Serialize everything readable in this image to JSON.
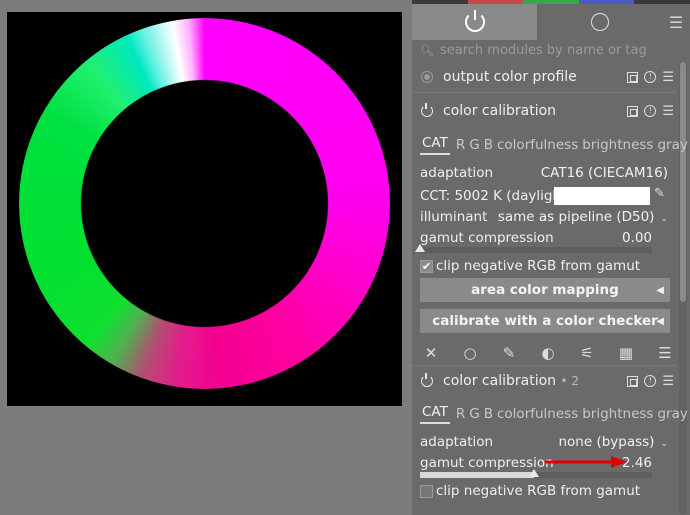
{
  "accent_colors": {
    "strip": [
      "#3a3a3a",
      "#c24a4a",
      "#3aa84a",
      "#4a5ac2",
      "#3a3a3a"
    ],
    "checkbox": "#8c8c8c"
  },
  "tabs": {
    "active_icon": "power-icon",
    "inactive_icon": "circle-icon",
    "menu_icon": "hamburger-icon"
  },
  "search": {
    "placeholder": "search modules by name or tag"
  },
  "modules": {
    "output_profile": {
      "title": "output color profile"
    },
    "calib1": {
      "title": "color calibration",
      "tabs": [
        "CAT",
        "R",
        "G",
        "B",
        "colorfulness",
        "brightness",
        "gray"
      ],
      "adaptation_label": "adaptation",
      "adaptation_value": "CAT16 (CIECAM16)",
      "cct_text": "CCT: 5002 K (daylight)",
      "illuminant_label": "illuminant",
      "illuminant_value": "same as pipeline (D50)",
      "gamut_label": "gamut compression",
      "gamut_value": "0.00",
      "gamut_fraction": 0.0,
      "clip_label": "clip negative RGB from gamut",
      "clip_checked": true,
      "btn_area": "area color mapping",
      "btn_checker": "calibrate with a color checker"
    },
    "calib2": {
      "title": "color calibration",
      "instance": "• 2",
      "tabs": [
        "CAT",
        "R",
        "G",
        "B",
        "colorfulness",
        "brightness",
        "gray"
      ],
      "adaptation_label": "adaptation",
      "adaptation_value": "none (bypass)",
      "gamut_label": "gamut compression",
      "gamut_value": "2.46",
      "gamut_fraction": 0.49,
      "clip_label": "clip negative RGB from gamut",
      "clip_checked": false
    }
  },
  "toolrow": [
    "close-icon",
    "circle-icon",
    "pencil-icon",
    "gradient-icon",
    "brush-icon",
    "mask-icon",
    "menu-icon"
  ]
}
